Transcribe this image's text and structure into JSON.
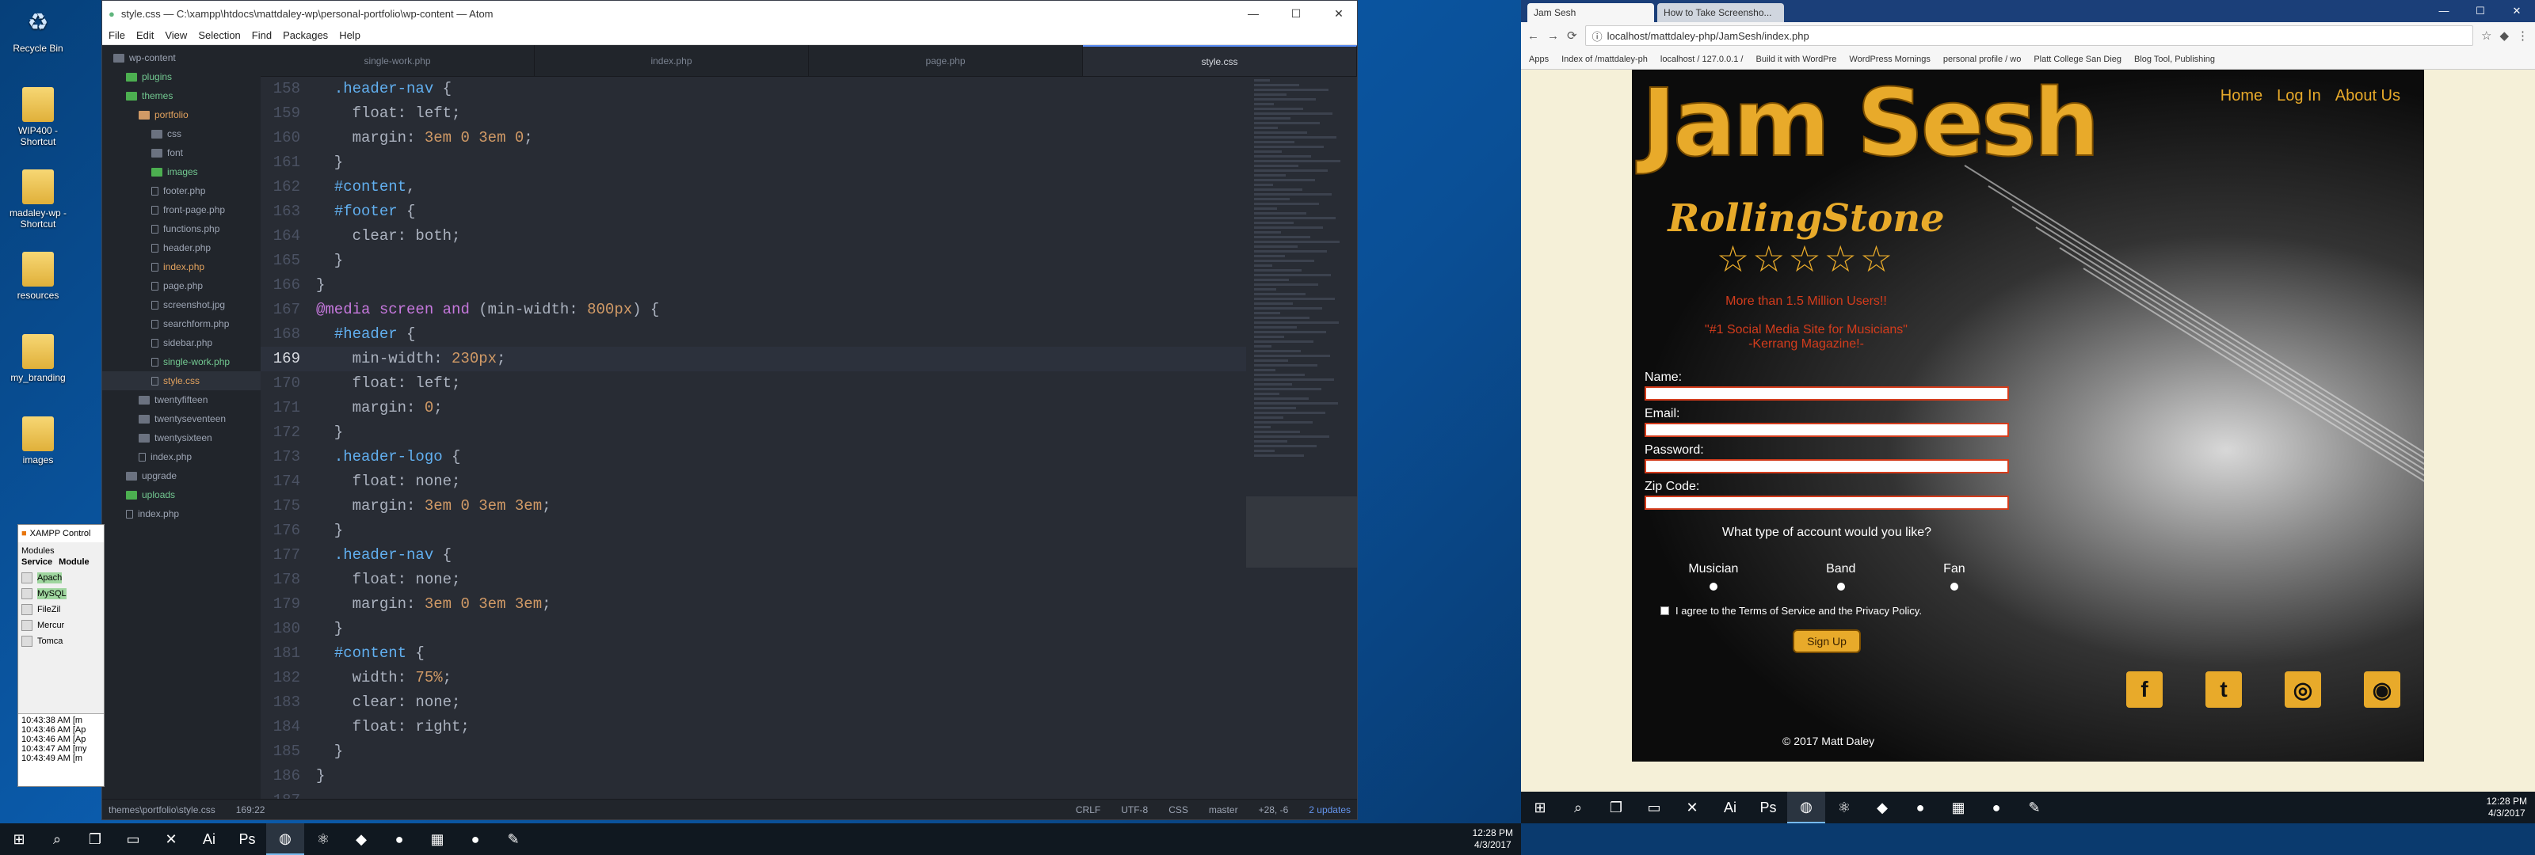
{
  "desktop": {
    "icons": [
      {
        "label": "Recycle Bin",
        "icon": "recycle-bin"
      },
      {
        "label": "WIP400 - Shortcut",
        "icon": "folder"
      },
      {
        "label": "madaley-wp - Shortcut",
        "icon": "folder"
      },
      {
        "label": "resources",
        "icon": "folder"
      },
      {
        "label": "my_branding",
        "icon": "folder"
      },
      {
        "label": "images",
        "icon": "folder"
      }
    ]
  },
  "atom": {
    "title": "style.css — C:\\xampp\\htdocs\\mattdaley-wp\\personal-portfolio\\wp-content — Atom",
    "menu": [
      "File",
      "Edit",
      "View",
      "Selection",
      "Find",
      "Packages",
      "Help"
    ],
    "tabs": [
      "single-work.php",
      "index.php",
      "page.php",
      "style.css"
    ],
    "tree": [
      {
        "label": "wp-content",
        "indent": 0,
        "type": "gray"
      },
      {
        "label": "plugins",
        "indent": 1,
        "type": "green"
      },
      {
        "label": "themes",
        "indent": 1,
        "type": "green"
      },
      {
        "label": "portfolio",
        "indent": 2,
        "type": "orange"
      },
      {
        "label": "css",
        "indent": 3,
        "type": "gray"
      },
      {
        "label": "font",
        "indent": 3,
        "type": "gray"
      },
      {
        "label": "images",
        "indent": 3,
        "type": "green"
      },
      {
        "label": "footer.php",
        "indent": 3,
        "type": "file"
      },
      {
        "label": "front-page.php",
        "indent": 3,
        "type": "file"
      },
      {
        "label": "functions.php",
        "indent": 3,
        "type": "file"
      },
      {
        "label": "header.php",
        "indent": 3,
        "type": "file"
      },
      {
        "label": "index.php",
        "indent": 3,
        "type": "file"
      },
      {
        "label": "page.php",
        "indent": 3,
        "type": "file"
      },
      {
        "label": "screenshot.jpg",
        "indent": 3,
        "type": "file"
      },
      {
        "label": "searchform.php",
        "indent": 3,
        "type": "file"
      },
      {
        "label": "sidebar.php",
        "indent": 3,
        "type": "file"
      },
      {
        "label": "single-work.php",
        "indent": 3,
        "type": "file"
      },
      {
        "label": "style.css",
        "indent": 3,
        "type": "file"
      },
      {
        "label": "twentyfifteen",
        "indent": 2,
        "type": "gray"
      },
      {
        "label": "twentyseventeen",
        "indent": 2,
        "type": "gray"
      },
      {
        "label": "twentysixteen",
        "indent": 2,
        "type": "gray"
      },
      {
        "label": "index.php",
        "indent": 2,
        "type": "file"
      },
      {
        "label": "upgrade",
        "indent": 1,
        "type": "gray"
      },
      {
        "label": "uploads",
        "indent": 1,
        "type": "green"
      },
      {
        "label": "index.php",
        "indent": 1,
        "type": "file"
      }
    ],
    "code": [
      {
        "n": "158",
        "t": "  .header-nav {"
      },
      {
        "n": "159",
        "t": "    float: left;"
      },
      {
        "n": "160",
        "t": "    margin: 3em 0 3em 0;"
      },
      {
        "n": "161",
        "t": "  }"
      },
      {
        "n": "162",
        "t": "  #content,"
      },
      {
        "n": "163",
        "t": "  #footer {"
      },
      {
        "n": "164",
        "t": "    clear: both;"
      },
      {
        "n": "165",
        "t": "  }"
      },
      {
        "n": "166",
        "t": "}"
      },
      {
        "n": "167",
        "t": "@media screen and (min-width: 800px) {"
      },
      {
        "n": "168",
        "t": "  #header {"
      },
      {
        "n": "169",
        "t": "    min-width: 230px;"
      },
      {
        "n": "170",
        "t": "    float: left;"
      },
      {
        "n": "171",
        "t": "    margin: 0;"
      },
      {
        "n": "172",
        "t": "  }"
      },
      {
        "n": "173",
        "t": "  .header-logo {"
      },
      {
        "n": "174",
        "t": "    float: none;"
      },
      {
        "n": "175",
        "t": "    margin: 3em 0 3em 3em;"
      },
      {
        "n": "176",
        "t": "  }"
      },
      {
        "n": "177",
        "t": "  .header-nav {"
      },
      {
        "n": "178",
        "t": "    float: none;"
      },
      {
        "n": "179",
        "t": "    margin: 3em 0 3em 3em;"
      },
      {
        "n": "180",
        "t": "  }"
      },
      {
        "n": "181",
        "t": "  #content {"
      },
      {
        "n": "182",
        "t": "    width: 75%;"
      },
      {
        "n": "183",
        "t": "    clear: none;"
      },
      {
        "n": "184",
        "t": "    float: right;"
      },
      {
        "n": "185",
        "t": "  }"
      },
      {
        "n": "186",
        "t": "}"
      },
      {
        "n": "187",
        "t": ""
      }
    ],
    "status": {
      "path": "themes\\portfolio\\style.css",
      "pos": "169:22",
      "eol": "CRLF",
      "enc": "UTF-8",
      "grammar": "CSS",
      "branch": "master",
      "diff": "+28, -6",
      "updates": "2 updates"
    }
  },
  "xampp": {
    "title": "XAMPP Control",
    "modules_label": "Modules",
    "service_label": "Service",
    "module_label": "Module",
    "modules": [
      "Apach",
      "MySQL",
      "FileZil",
      "Mercur",
      "Tomca"
    ],
    "log": [
      "10:43:38 AM [m",
      "10:43:46 AM [Ap",
      "10:43:46 AM [Ap",
      "10:43:47 AM [my",
      "10:43:49 AM [m"
    ]
  },
  "taskbar1": {
    "time": "12:28 PM",
    "date": "4/3/2017"
  },
  "chrome": {
    "tabs": [
      "Jam Sesh",
      "How to Take Screensho..."
    ],
    "url": "localhost/mattdaley-php/JamSesh/index.php",
    "bookmarks": [
      "Apps",
      "Index of /mattdaley-ph",
      "localhost / 127.0.0.1 /",
      "Build it with WordPre",
      "WordPress Mornings",
      "personal profile / wo",
      "Platt College San Dieg",
      "Blog Tool, Publishing"
    ]
  },
  "site": {
    "logo": "Jam Sesh",
    "nav": [
      "Home",
      "Log In",
      "About Us"
    ],
    "review_brand": "RollingStone",
    "stars": "☆☆☆☆☆",
    "stat": "More than 1.5 Million Users!!",
    "quote": "\"#1 Social Media Site for Musicians\"",
    "quote_src": "-Kerrang Magazine!-",
    "fields": [
      "Name:",
      "Email:",
      "Password:",
      "Zip Code:"
    ],
    "account_q": "What type of account would you like?",
    "account_types": [
      "Musician",
      "Band",
      "Fan"
    ],
    "terms": "I agree to the Terms of Service and the Privacy Policy.",
    "signup": "Sign Up",
    "copyright": "© 2017 Matt Daley",
    "social": [
      {
        "icon": "facebook-icon",
        "glyph": "f"
      },
      {
        "icon": "twitter-icon",
        "glyph": "t"
      },
      {
        "icon": "instagram-icon",
        "glyph": "◎"
      },
      {
        "icon": "rss-icon",
        "glyph": "◉"
      }
    ]
  },
  "taskbar2": {
    "time": "12:28 PM",
    "date": "4/3/2017"
  }
}
